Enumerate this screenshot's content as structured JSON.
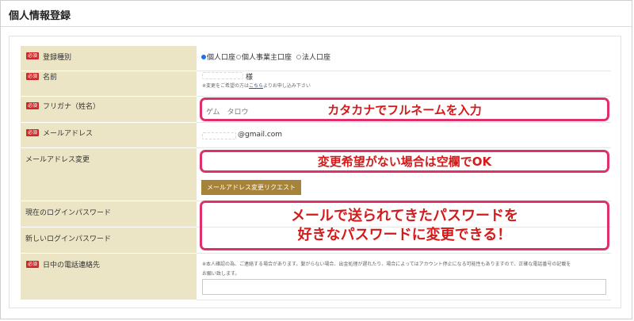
{
  "page": {
    "title": "個人情報登録"
  },
  "form": {
    "required_badge": "必須",
    "account_type": {
      "label": "登録種別",
      "options": [
        "個人口座",
        "個人事業主口座",
        "法人口座"
      ],
      "selected": "個人口座"
    },
    "name": {
      "label": "名前",
      "suffix": "様",
      "note_prefix": "※変更をご希望の方は",
      "note_link": "こちら",
      "note_suffix": "よりお申し込み下さい"
    },
    "furigana": {
      "label": "フリガナ（姓名）",
      "value": "ゲム　タロウ"
    },
    "email": {
      "label": "メールアドレス",
      "domain": "@gmail.com"
    },
    "email_change": {
      "label": "メールアドレス変更",
      "button_label": "メールアドレス変更リクエスト"
    },
    "current_password": {
      "label": "現在のログインパスワード"
    },
    "new_password": {
      "label": "新しいログインパスワード"
    },
    "phone": {
      "label": "日中の電話連絡先",
      "note_line1": "※本人確認の為、ご連絡する場合があります。繋がらない場合、出金処理が遅れたり、場合によってはアカウント停止になる可能性もありますので、正確な電話番号の記載を",
      "note_line2": "お願い致します。"
    }
  },
  "annotations": {
    "furigana": "カタカナでフルネームを入力",
    "email_change": "変更希望がない場合は空欄でOK",
    "password_line1": "メールで送られてきたパスワードを",
    "password_line2": "好きなパスワードに変更できる！",
    "border_color": "#e0306a",
    "text_color": "#d41a1a"
  },
  "colors": {
    "label_bg": "#ece5c5",
    "required_badge": "#cc2a2a",
    "button_bg": "#a78339",
    "link": "#1a55c8"
  }
}
